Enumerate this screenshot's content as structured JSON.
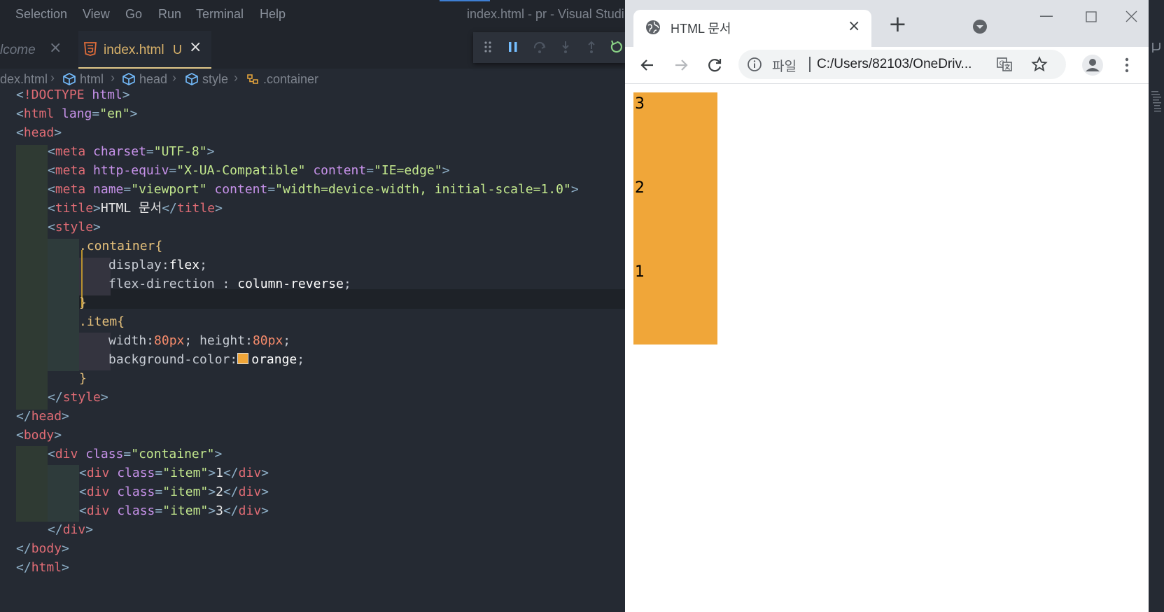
{
  "vscode": {
    "menu": [
      "Selection",
      "View",
      "Go",
      "Run",
      "Terminal",
      "Help"
    ],
    "window_title": "index.html - pr - Visual Studi",
    "tabs": [
      {
        "label": "lcome",
        "close": "×"
      },
      {
        "label": "index.html",
        "status": "U",
        "close": "×"
      }
    ],
    "breadcrumb": [
      "dex.html",
      "html",
      "head",
      "style",
      ".container"
    ],
    "code_lines": [
      "<!DOCTYPE html>",
      "<html lang=\"en\">",
      "<head>",
      "<meta charset=\"UTF-8\">",
      "<meta http-equiv=\"X-UA-Compatible\" content=\"IE=edge\">",
      "<meta name=\"viewport\" content=\"width=device-width, initial-scale=1.0\">",
      "<title>HTML 문서</title>",
      "<style>",
      ".container{",
      "display:flex;",
      "flex-direction : column-reverse;",
      "}",
      ".item{",
      "width:80px; height:80px;",
      "background-color: orange;",
      "}",
      "</style>",
      "</head>",
      "<body>",
      "<div class=\"container\">",
      "<div class=\"item\">1</div>",
      "<div class=\"item\">2</div>",
      "<div class=\"item\">3</div>",
      "</div>",
      "</body>",
      "</html>"
    ],
    "colors": {
      "swatch": "#f0a639",
      "tab_accent": "#e3c98a"
    }
  },
  "browser": {
    "tab_title": "HTML 문서",
    "tab_close": "×",
    "new_tab": "+",
    "scheme_label": "파일",
    "url": "C:/Users/82103/OneDriv...",
    "icons": [
      "globe-icon",
      "back-arrow-icon",
      "forward-arrow-icon",
      "reload-icon",
      "info-icon",
      "translate-icon",
      "star-icon",
      "profile-icon",
      "menu-dots-icon"
    ],
    "items_displayed": [
      "3",
      "2",
      "1"
    ],
    "item_color": "#f0a639"
  }
}
